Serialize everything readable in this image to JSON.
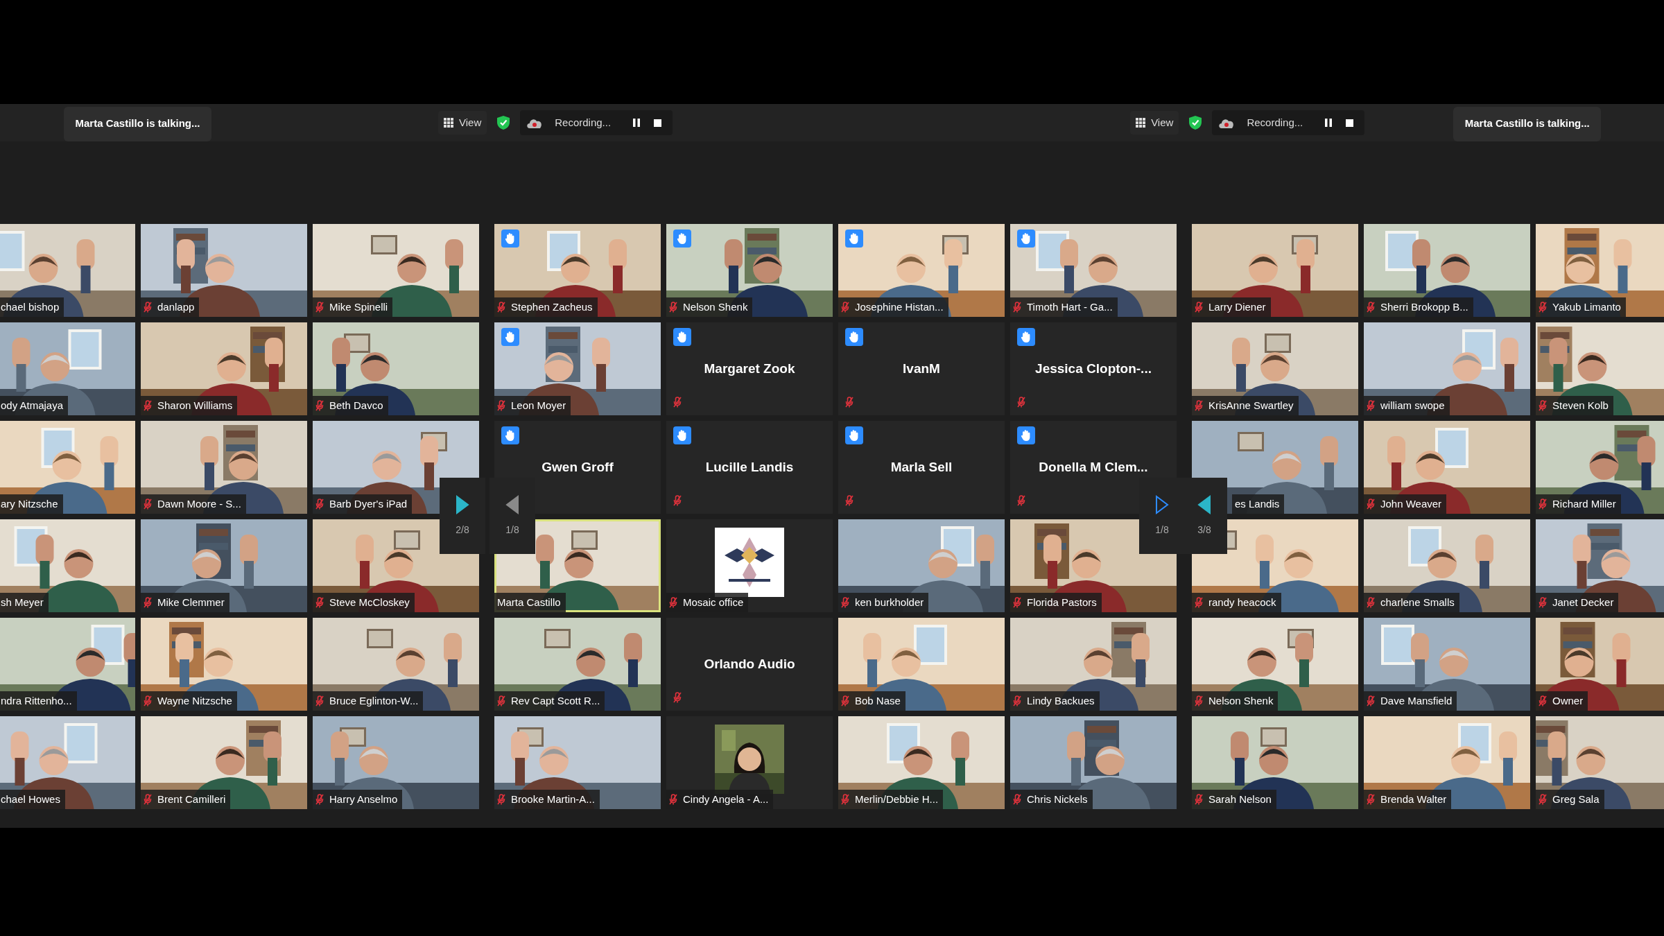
{
  "header": {
    "left_status": "Marta Castillo is talking...",
    "right_status": "Marta Castillo is talking...",
    "toolbars": [
      {
        "view_label": "View",
        "recording_label": "Recording..."
      },
      {
        "view_label": "View",
        "recording_label": "Recording..."
      }
    ]
  },
  "galleries": [
    {
      "pager": [
        {
          "label": "2/8",
          "kind": "next"
        }
      ],
      "tiles": [
        {
          "name": "chael bishop",
          "kind": "video",
          "hand_raised": false,
          "speaking": false
        },
        {
          "name": "danlapp",
          "kind": "video",
          "muted": true,
          "hand_raised": false,
          "speaking": false
        },
        {
          "name": "Mike Spinelli",
          "kind": "video",
          "muted": true,
          "hand_raised": false,
          "speaking": false
        },
        {
          "name": "ody Atmajaya",
          "kind": "video",
          "hand_raised": false,
          "speaking": false
        },
        {
          "name": "Sharon Williams",
          "kind": "video",
          "muted": true,
          "hand_raised": false,
          "speaking": false
        },
        {
          "name": "Beth Davco",
          "kind": "video",
          "muted": true,
          "hand_raised": false,
          "speaking": false
        },
        {
          "name": "ary Nitzsche",
          "kind": "video",
          "hand_raised": false,
          "speaking": false
        },
        {
          "name": "Dawn Moore - S...",
          "kind": "video",
          "muted": true,
          "hand_raised": false,
          "speaking": false
        },
        {
          "name": "Barb Dyer's iPad",
          "kind": "video",
          "muted": true,
          "hand_raised": false,
          "speaking": false
        },
        {
          "name": "sh Meyer",
          "kind": "video",
          "hand_raised": false,
          "speaking": false
        },
        {
          "name": "Mike Clemmer",
          "kind": "video",
          "muted": true,
          "hand_raised": false,
          "speaking": false
        },
        {
          "name": "Steve McCloskey",
          "kind": "video",
          "muted": true,
          "hand_raised": false,
          "speaking": false
        },
        {
          "name": "ndra Rittenho...",
          "kind": "video",
          "hand_raised": false,
          "speaking": false
        },
        {
          "name": "Wayne Nitzsche",
          "kind": "video",
          "muted": true,
          "hand_raised": false,
          "speaking": false
        },
        {
          "name": "Bruce Eglinton-W...",
          "kind": "video",
          "muted": true,
          "hand_raised": false,
          "speaking": false
        },
        {
          "name": "chael Howes",
          "kind": "video",
          "hand_raised": false,
          "speaking": false
        },
        {
          "name": "Brent Camilleri",
          "kind": "video",
          "muted": true,
          "hand_raised": false,
          "speaking": false
        },
        {
          "name": "Harry Anselmo",
          "kind": "video",
          "muted": true,
          "hand_raised": false,
          "speaking": false
        }
      ]
    },
    {
      "pager": [
        {
          "label": "1/8",
          "kind": "prevdim"
        },
        {
          "label": "1/8",
          "kind": "nextoutline"
        }
      ],
      "tiles": [
        {
          "name": "Stephen Zacheus",
          "kind": "video",
          "muted": true,
          "hand_raised": true,
          "speaking": false
        },
        {
          "name": "Nelson Shenk",
          "kind": "video",
          "muted": true,
          "hand_raised": true,
          "speaking": false
        },
        {
          "name": "Josephine Histan...",
          "kind": "video",
          "muted": true,
          "hand_raised": true,
          "speaking": false
        },
        {
          "name": "Timoth Hart - Ga...",
          "kind": "video",
          "muted": true,
          "hand_raised": true,
          "speaking": false
        },
        {
          "name": "Leon Moyer",
          "kind": "video",
          "muted": true,
          "hand_raised": true,
          "speaking": false
        },
        {
          "name": "Margaret Zook",
          "kind": "name",
          "muted": true,
          "hand_raised": true,
          "speaking": false
        },
        {
          "name": "IvanM",
          "kind": "name",
          "muted": true,
          "hand_raised": true,
          "speaking": false
        },
        {
          "name": "Jessica Clopton-...",
          "kind": "name",
          "muted": true,
          "hand_raised": true,
          "speaking": false
        },
        {
          "name": "Gwen Groff",
          "kind": "name",
          "hand_raised": true,
          "speaking": false
        },
        {
          "name": "Lucille Landis",
          "kind": "name",
          "muted": true,
          "hand_raised": true,
          "speaking": false
        },
        {
          "name": "Marla Sell",
          "kind": "name",
          "muted": true,
          "hand_raised": true,
          "speaking": false
        },
        {
          "name": "Donella M Clem...",
          "kind": "name",
          "muted": true,
          "hand_raised": true,
          "speaking": false
        },
        {
          "name": "Marta Castillo",
          "kind": "video",
          "muted": false,
          "hand_raised": false,
          "speaking": true
        },
        {
          "name": "Mosaic office",
          "kind": "logo",
          "muted": true,
          "hand_raised": false,
          "speaking": false
        },
        {
          "name": "ken burkholder",
          "kind": "video",
          "muted": true,
          "hand_raised": false,
          "speaking": false
        },
        {
          "name": "Florida Pastors",
          "kind": "video",
          "muted": true,
          "hand_raised": false,
          "speaking": false
        },
        {
          "name": "Rev Capt Scott R...",
          "kind": "video",
          "muted": true,
          "hand_raised": false,
          "speaking": false
        },
        {
          "name": "Orlando Audio",
          "kind": "name",
          "muted": true,
          "hand_raised": false,
          "speaking": false
        },
        {
          "name": "Bob Nase",
          "kind": "video",
          "muted": true,
          "hand_raised": false,
          "speaking": false
        },
        {
          "name": "Lindy Backues",
          "kind": "video",
          "muted": true,
          "hand_raised": false,
          "speaking": false
        },
        {
          "name": "Brooke Martin-A...",
          "kind": "video",
          "muted": true,
          "hand_raised": false,
          "speaking": false
        },
        {
          "name": "Cindy Angela - A...",
          "kind": "avatar",
          "muted": true,
          "hand_raised": false,
          "speaking": false
        },
        {
          "name": "Merlin/Debbie H...",
          "kind": "video",
          "muted": true,
          "hand_raised": false,
          "speaking": false
        },
        {
          "name": "Chris Nickels",
          "kind": "video",
          "muted": true,
          "hand_raised": false,
          "speaking": false
        }
      ]
    },
    {
      "pager": [
        {
          "label": "3/8",
          "kind": "prev"
        }
      ],
      "tiles": [
        {
          "name": "Larry Diener",
          "kind": "video",
          "muted": true,
          "hand_raised": false,
          "speaking": false
        },
        {
          "name": "Sherri Brokopp B...",
          "kind": "video",
          "muted": true,
          "hand_raised": false,
          "speaking": false
        },
        {
          "name": "Yakub Limanto",
          "kind": "video",
          "muted": true,
          "hand_raised": false,
          "speaking": false
        },
        {
          "name": "KrisAnne Swartley",
          "kind": "video",
          "muted": true,
          "hand_raised": false,
          "speaking": false
        },
        {
          "name": "william swope",
          "kind": "video",
          "muted": true,
          "hand_raised": false,
          "speaking": false
        },
        {
          "name": "Steven Kolb",
          "kind": "video",
          "muted": true,
          "hand_raised": false,
          "speaking": false
        },
        {
          "name": "es Landis",
          "kind": "video",
          "hand_raised": false,
          "speaking": false
        },
        {
          "name": "John Weaver",
          "kind": "video",
          "muted": true,
          "hand_raised": false,
          "speaking": false
        },
        {
          "name": "Richard Miller",
          "kind": "video",
          "muted": true,
          "hand_raised": false,
          "speaking": false
        },
        {
          "name": "randy heacock",
          "kind": "video",
          "muted": true,
          "hand_raised": false,
          "speaking": false
        },
        {
          "name": "charlene Smalls",
          "kind": "video",
          "muted": true,
          "hand_raised": false,
          "speaking": false
        },
        {
          "name": "Janet Decker",
          "kind": "video",
          "muted": true,
          "hand_raised": false,
          "speaking": false
        },
        {
          "name": "Nelson Shenk",
          "kind": "video",
          "muted": true,
          "hand_raised": false,
          "speaking": false
        },
        {
          "name": "Dave Mansfield",
          "kind": "video",
          "muted": true,
          "hand_raised": false,
          "speaking": false
        },
        {
          "name": "Owner",
          "kind": "video",
          "muted": true,
          "hand_raised": false,
          "speaking": false
        },
        {
          "name": "Sarah Nelson",
          "kind": "video",
          "muted": true,
          "hand_raised": false,
          "speaking": false
        },
        {
          "name": "Brenda Walter",
          "kind": "video",
          "muted": true,
          "hand_raised": false,
          "speaking": false
        },
        {
          "name": "Greg Sala",
          "kind": "video",
          "muted": true,
          "hand_raised": false,
          "speaking": false
        }
      ]
    }
  ]
}
